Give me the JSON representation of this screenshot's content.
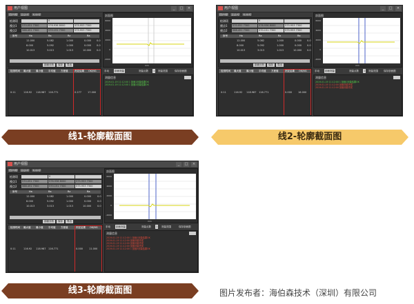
{
  "window": {
    "title": "用户视图",
    "buttons": [
      "_",
      "□",
      "×"
    ],
    "tabs": [
      "用户视图",
      "高级视图",
      "系统视图"
    ]
  },
  "inputs": {
    "row1_label": "检测项",
    "row1_values": [
      "",
      "0",
      ""
    ],
    "row2_label": "视点1",
    "row2_values": [
      "570.051 7300",
      "576.936 8000",
      "575.953 7300"
    ],
    "row3_label": "视点2",
    "row3_values": [
      "568.451 7300",
      "570.151 7300",
      "575.953 7300"
    ]
  },
  "table": {
    "columns": [
      "序号",
      "Ha",
      "Ra",
      "Rz",
      "Ra"
    ],
    "rows": [
      [
        "",
        "12.000",
        "5.082",
        "1.000",
        "0.000",
        "0.0"
      ],
      [
        "",
        "8.000",
        "5.092",
        "1.000",
        "0.000",
        "0.0"
      ],
      [
        "",
        "10.013",
        "3.013",
        "1.013",
        "10.000",
        "0.0"
      ]
    ]
  },
  "status_buttons": [
    "剖面分析",
    "保存",
    "导出"
  ],
  "chart": {
    "label": "剖面图",
    "y_ticks": [
      "6000",
      "5000",
      "4000",
      "3000",
      "2000",
      "1000",
      "0",
      "-1000",
      "-2000"
    ],
    "x_label": "mm"
  },
  "toolbar": {
    "mode_label": "手动",
    "mode_button": "剖面测量",
    "point_label": "测量点数",
    "point_value": "1",
    "range_label": "测量范围",
    "select_label": "保存剖面图"
  },
  "log": {
    "header": "测量信息",
    "lines_green": [
      "2019-01-19 11:12:00 1 剖面1测量结果OK",
      "2019-01-19 11:12:00 1 剖面2测量结果OK",
      "2019-01-19 11:12:00 1 剖面3测量结果OK"
    ],
    "lines_red": [
      "2019-01-19 11:12:00 剖面测量完成",
      "2019-01-19 11:12:00 剖面测量完成",
      "2019-01-19 11:12:00 剖面测量完成"
    ]
  },
  "bottom": {
    "headers": [
      "检测时间",
      "最大值",
      "最小值",
      "平均值",
      "方差值",
      "判定结果",
      "OK/NG"
    ],
    "values_1": [
      "0:11",
      "116.92",
      "118.987",
      "116.771",
      "0.277",
      "17.000"
    ],
    "values_2": [
      "0:11",
      "116.92",
      "118.987",
      "116.771",
      "0.000",
      "16.000"
    ],
    "values_3": [
      "0:11",
      "116.92",
      "118.987",
      "116.771",
      "0.000",
      "11.000"
    ]
  },
  "banners": {
    "b1": "线1-轮廓截面图",
    "b2": "线2-轮廓截面图",
    "b3": "线3-轮廓截面图"
  },
  "caption": "图片发布者：海伯森技术（深圳）有限公司",
  "colors": {
    "banner_dark": "#7a3e22",
    "banner_light": "#f6c96a",
    "profile_line": "#d7d60f",
    "marker_line": "#4b61c8",
    "highlight": "#d12a2a"
  }
}
